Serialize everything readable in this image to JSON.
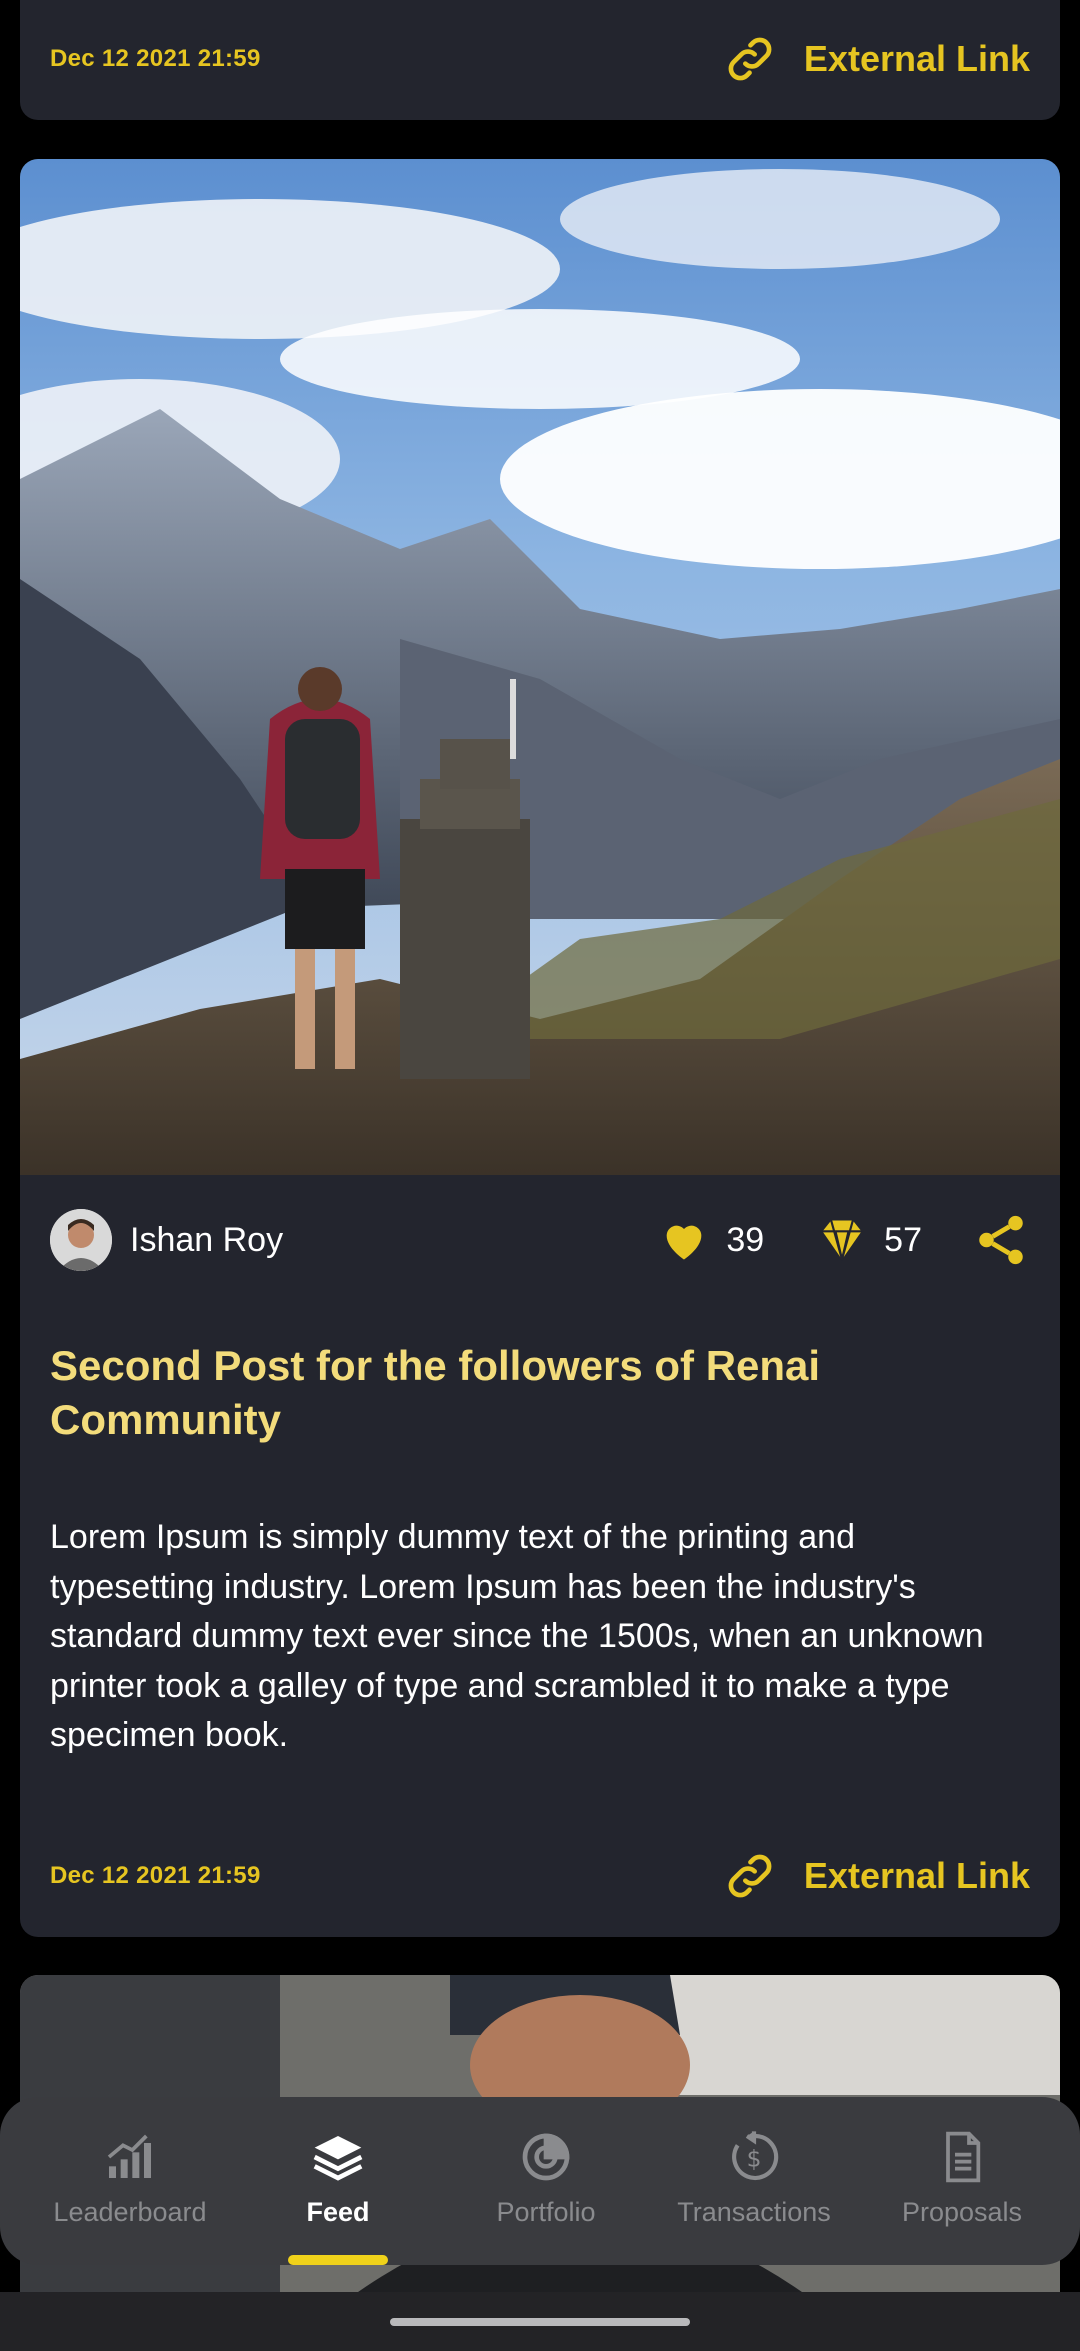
{
  "top_card": {
    "date": "Dec 12 2021 21:59",
    "link_label": "External Link"
  },
  "post": {
    "author": "Ishan Roy",
    "likes": "39",
    "gems": "57",
    "title": "Second Post for the followers of Renai Community",
    "body": "Lorem Ipsum is simply dummy text of the printing and typesetting industry. Lorem Ipsum has been the industry's standard dummy text ever since the 1500s, when an unknown printer took a galley of type and scrambled it to make a type specimen book.",
    "date": "Dec 12 2021 21:59",
    "link_label": "External Link"
  },
  "nav": {
    "items": [
      {
        "label": "Leaderboard",
        "icon": "leaderboard-icon",
        "active": false
      },
      {
        "label": "Feed",
        "icon": "feed-icon",
        "active": true
      },
      {
        "label": "Portfolio",
        "icon": "portfolio-icon",
        "active": false
      },
      {
        "label": "Transactions",
        "icon": "transactions-icon",
        "active": false
      },
      {
        "label": "Proposals",
        "icon": "proposals-icon",
        "active": false
      }
    ]
  },
  "colors": {
    "accent": "#e6c521",
    "title": "#f3dc7b",
    "card": "#23252e",
    "nav_bg": "#3a3b3f"
  }
}
